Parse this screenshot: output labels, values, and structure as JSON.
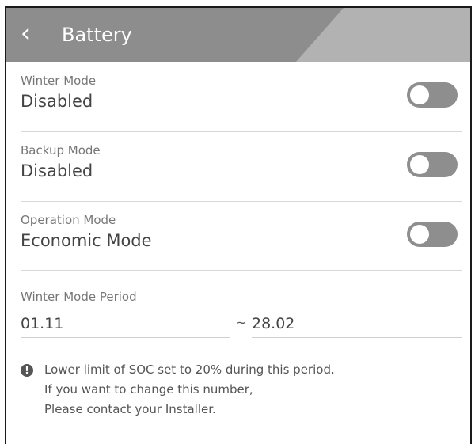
{
  "header": {
    "title": "Battery",
    "back_icon": "chevron-left-icon"
  },
  "settings": [
    {
      "label": "Winter Mode",
      "value": "Disabled",
      "toggle_on": false
    },
    {
      "label": "Backup Mode",
      "value": "Disabled",
      "toggle_on": false
    },
    {
      "label": "Operation Mode",
      "value": "Economic Mode",
      "toggle_on": false
    }
  ],
  "period": {
    "label": "Winter Mode Period",
    "start": "01.11",
    "separator": "~",
    "end": "28.02"
  },
  "notice": {
    "icon": "exclamation-circle-icon",
    "lines": [
      "Lower limit of SOC set to 20% during this period.",
      "If you want to change this number,",
      "Please contact your Installer."
    ]
  },
  "colors": {
    "header": "#8d8d8d",
    "toggle_off": "#8e8e8e"
  }
}
